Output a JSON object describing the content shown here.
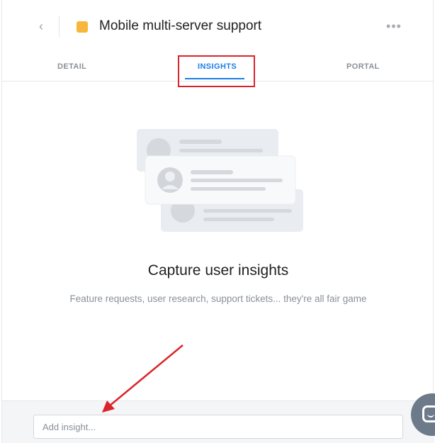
{
  "header": {
    "title": "Mobile multi-server support",
    "back_icon": "‹",
    "more_icon": "•••",
    "color_swatch": "#f6b73c"
  },
  "tabs": [
    {
      "label": "DETAIL",
      "active": false
    },
    {
      "label": "INSIGHTS",
      "active": true
    },
    {
      "label": "PORTAL",
      "active": false
    }
  ],
  "empty_state": {
    "title": "Capture user insights",
    "subtitle": "Feature requests, user research, support tickets... they're all fair game"
  },
  "footer": {
    "input_placeholder": "Add insight...",
    "input_value": ""
  },
  "colors": {
    "accent": "#1b7ee6",
    "highlight": "#d9242a",
    "chat_bubble": "#6c7a89"
  },
  "icons": {
    "back": "chevron-left-icon",
    "more": "more-horizontal-icon",
    "chat": "chat-icon"
  }
}
